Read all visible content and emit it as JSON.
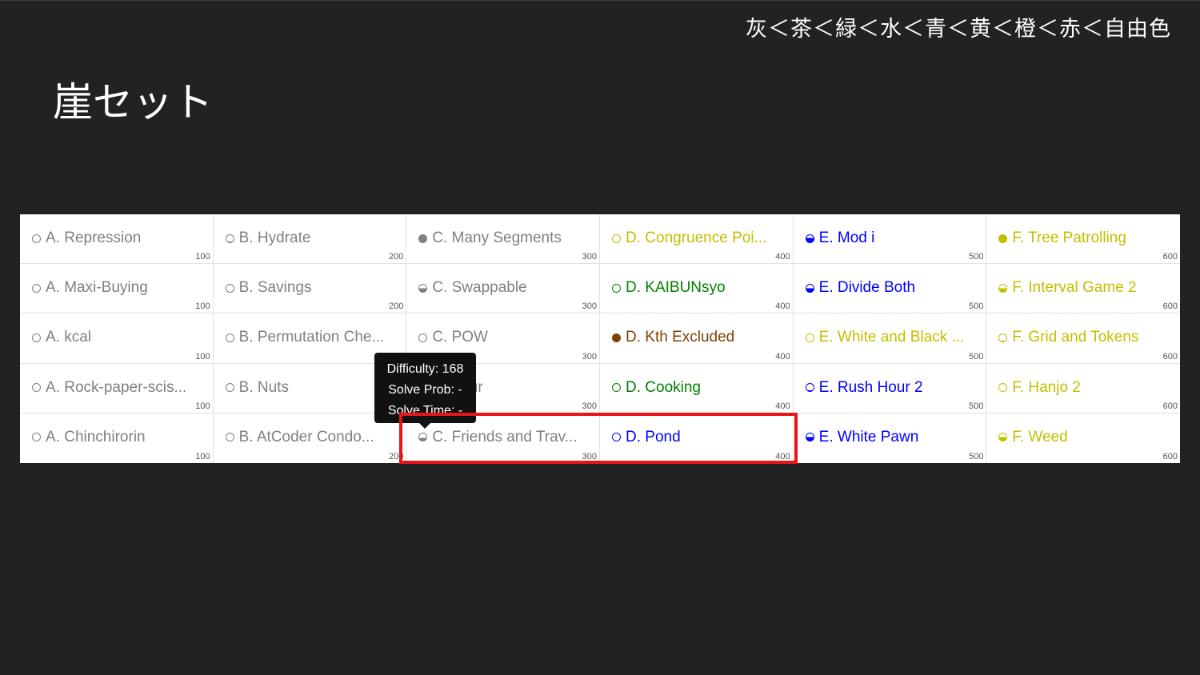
{
  "rank_order": "灰＜茶＜緑＜水＜青＜黄＜橙＜赤＜自由色",
  "slide_title": "崖セット",
  "colors": {
    "gray": "#808080",
    "brown": "#804000",
    "green": "#008000",
    "cyan": "#00c0c0",
    "blue": "#0000ff",
    "yellow": "#c0c000",
    "highlight": "#e8141c"
  },
  "grid": {
    "rows": [
      [
        {
          "title": "A. Repression",
          "points": "100",
          "color": "gray",
          "fill": 0
        },
        {
          "title": "B. Hydrate",
          "points": "200",
          "color": "gray",
          "fill": 0.1
        },
        {
          "title": "C. Many Segments",
          "points": "300",
          "color": "gray",
          "fill": 1
        },
        {
          "title": "D. Congruence Poi...",
          "points": "400",
          "color": "yellow",
          "fill": 0
        },
        {
          "title": "E. Mod i",
          "points": "500",
          "color": "blue",
          "fill": 0.6
        },
        {
          "title": "F. Tree Patrolling",
          "points": "600",
          "color": "yellow",
          "fill": 1
        }
      ],
      [
        {
          "title": "A. Maxi-Buying",
          "points": "100",
          "color": "gray",
          "fill": 0
        },
        {
          "title": "B. Savings",
          "points": "200",
          "color": "gray",
          "fill": 0
        },
        {
          "title": "C. Swappable",
          "points": "300",
          "color": "gray",
          "fill": 0.5
        },
        {
          "title": "D. KAIBUNsyo",
          "points": "400",
          "color": "green",
          "fill": 0
        },
        {
          "title": "E. Divide Both",
          "points": "500",
          "color": "blue",
          "fill": 0.5
        },
        {
          "title": "F. Interval Game 2",
          "points": "600",
          "color": "yellow",
          "fill": 0.5
        }
      ],
      [
        {
          "title": "A. kcal",
          "points": "100",
          "color": "gray",
          "fill": 0
        },
        {
          "title": "B. Permutation Che...",
          "points": "200",
          "color": "gray",
          "fill": 0
        },
        {
          "title": "C. POW",
          "points": "300",
          "color": "gray",
          "fill": 0
        },
        {
          "title": "D. Kth Excluded",
          "points": "400",
          "color": "brown",
          "fill": 1
        },
        {
          "title": "E. White and Black ...",
          "points": "500",
          "color": "yellow",
          "fill": 0
        },
        {
          "title": "F. Grid and Tokens",
          "points": "600",
          "color": "yellow",
          "fill": 0.1
        }
      ],
      [
        {
          "title": "A. Rock-paper-scis...",
          "points": "100",
          "color": "gray",
          "fill": 0
        },
        {
          "title": "B. Nuts",
          "points": "200",
          "color": "gray",
          "fill": 0
        },
        {
          "title": "C. Four",
          "points": "300",
          "color": "gray",
          "fill": 0
        },
        {
          "title": "D. Cooking",
          "points": "400",
          "color": "green",
          "fill": 0
        },
        {
          "title": "E. Rush Hour 2",
          "points": "500",
          "color": "blue",
          "fill": 0.1
        },
        {
          "title": "F. Hanjo 2",
          "points": "600",
          "color": "yellow",
          "fill": 0
        }
      ],
      [
        {
          "title": "A. Chinchirorin",
          "points": "100",
          "color": "gray",
          "fill": 0
        },
        {
          "title": "B. AtCoder Condo...",
          "points": "200",
          "color": "gray",
          "fill": 0
        },
        {
          "title": "C. Friends and Trav...",
          "points": "300",
          "color": "gray",
          "fill": 0.4
        },
        {
          "title": "D. Pond",
          "points": "400",
          "color": "blue",
          "fill": 0
        },
        {
          "title": "E. White Pawn",
          "points": "500",
          "color": "blue",
          "fill": 0.5
        },
        {
          "title": "F. Weed",
          "points": "600",
          "color": "yellow",
          "fill": 0.5
        }
      ]
    ]
  },
  "tooltip": {
    "difficulty": "Difficulty: 168",
    "solve_prob": "Solve Prob: -",
    "solve_time": "Solve Time: -"
  }
}
